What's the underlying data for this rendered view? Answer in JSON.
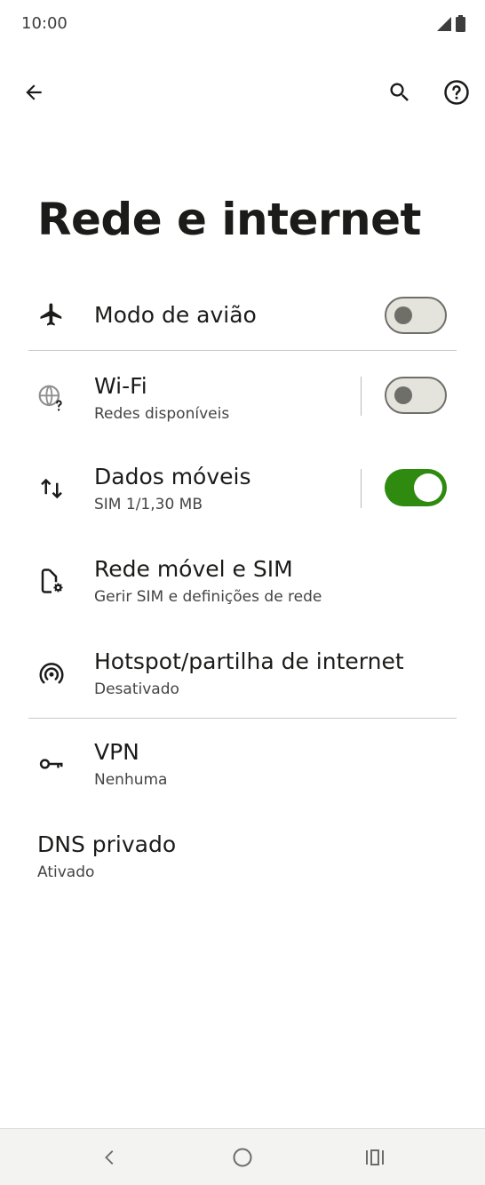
{
  "status": {
    "time": "10:00"
  },
  "toolbar": {
    "back_icon": "arrow-left-icon",
    "search_icon": "search-icon",
    "help_icon": "help-circle-icon"
  },
  "page": {
    "title": "Rede e internet"
  },
  "items": [
    {
      "title": "Modo de avião",
      "subtitle": "",
      "icon": "airplane-icon",
      "toggle": "off"
    },
    {
      "title": "Wi-Fi",
      "subtitle": "Redes disponíveis",
      "icon": "wifi-globe-icon",
      "toggle": "off"
    },
    {
      "title": "Dados móveis",
      "subtitle": "SIM 1/1,30 MB",
      "icon": "data-arrows-icon",
      "toggle": "on"
    },
    {
      "title": "Rede móvel e SIM",
      "subtitle": "Gerir SIM e definições de rede",
      "icon": "sim-settings-icon"
    },
    {
      "title": "Hotspot/partilha de internet",
      "subtitle": "Desativado",
      "icon": "hotspot-icon"
    },
    {
      "title": "VPN",
      "subtitle": "Nenhuma",
      "icon": "key-icon"
    },
    {
      "title": "DNS privado",
      "subtitle": "Ativado"
    }
  ],
  "colors": {
    "accent": "#2f8a10",
    "text": "#1b1c1a",
    "subtext": "#444444"
  }
}
